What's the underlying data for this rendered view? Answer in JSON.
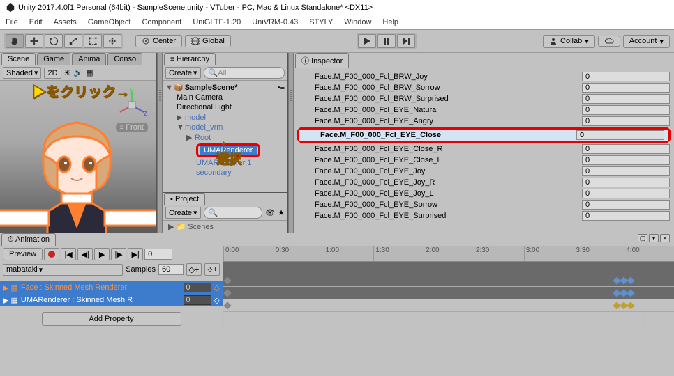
{
  "title": "Unity 2017.4.0f1 Personal (64bit) - SampleScene.unity - VTuber - PC, Mac & Linux Standalone* <DX11>",
  "menu": [
    "File",
    "Edit",
    "Assets",
    "GameObject",
    "Component",
    "UniGLTF-1.20",
    "UniVRM-0.43",
    "STYLY",
    "Window",
    "Help"
  ],
  "toolbar": {
    "center": "Center",
    "global": "Global",
    "collab": "Collab",
    "account": "Account"
  },
  "tabs_scene": [
    "Scene",
    "Game",
    "Anima",
    "Conso"
  ],
  "scene": {
    "shaded": "Shaded",
    "twod": "2D",
    "front": "Front"
  },
  "gizmo": {
    "y": "y",
    "z": "z"
  },
  "annot": {
    "click": "▶をクリック→",
    "select": "選択",
    "arrow": "↑"
  },
  "hierarchy": {
    "tab": "Hierarchy",
    "create": "Create",
    "search_ph": "All",
    "scene": "SampleScene*",
    "items": [
      "Main Camera",
      "Directional Light"
    ],
    "model": "model",
    "model_vrm": "model_vrm",
    "root": "Root",
    "umar": "UMARenderer",
    "umar1": "UMARenderer 1",
    "secondary": "secondary"
  },
  "project": {
    "tab": "Project",
    "create": "Create",
    "scenes": "Scenes"
  },
  "inspector": {
    "tab": "Inspector",
    "rows": [
      {
        "label": "Face.M_F00_000_Fcl_BRW_Joy",
        "val": "0"
      },
      {
        "label": "Face.M_F00_000_Fcl_BRW_Sorrow",
        "val": "0"
      },
      {
        "label": "Face.M_F00_000_Fcl_BRW_Surprised",
        "val": "0"
      },
      {
        "label": "Face.M_F00_000_Fcl_EYE_Natural",
        "val": "0"
      },
      {
        "label": "Face.M_F00_000_Fcl_EYE_Angry",
        "val": "0"
      },
      {
        "label": "Face.M_F00_000_Fcl_EYE_Close",
        "val": "0"
      },
      {
        "label": "Face.M_F00_000_Fcl_EYE_Close_R",
        "val": "0"
      },
      {
        "label": "Face.M_F00_000_Fcl_EYE_Close_L",
        "val": "0"
      },
      {
        "label": "Face.M_F00_000_Fcl_EYE_Joy",
        "val": "0"
      },
      {
        "label": "Face.M_F00_000_Fcl_EYE_Joy_R",
        "val": "0"
      },
      {
        "label": "Face.M_F00_000_Fcl_EYE_Joy_L",
        "val": "0"
      },
      {
        "label": "Face.M_F00_000_Fcl_EYE_Sorrow",
        "val": "0"
      },
      {
        "label": "Face.M_F00_000_Fcl_EYE_Surprised",
        "val": "0"
      }
    ],
    "highlight_index": 5
  },
  "animation": {
    "tab": "Animation",
    "preview": "Preview",
    "frame": "0",
    "clip": "mabataki",
    "samples_label": "Samples",
    "samples": "60",
    "tracks": [
      {
        "name": "Face : Skinned Mesh Renderer",
        "val": "0"
      },
      {
        "name": "UMARenderer : Skinned Mesh R",
        "val": "0"
      }
    ],
    "addprop": "Add Property",
    "ticks": [
      "0:00",
      "0:30",
      "1:00",
      "1:30",
      "2:00",
      "2:30",
      "3:00",
      "3:30",
      "4:00"
    ]
  }
}
